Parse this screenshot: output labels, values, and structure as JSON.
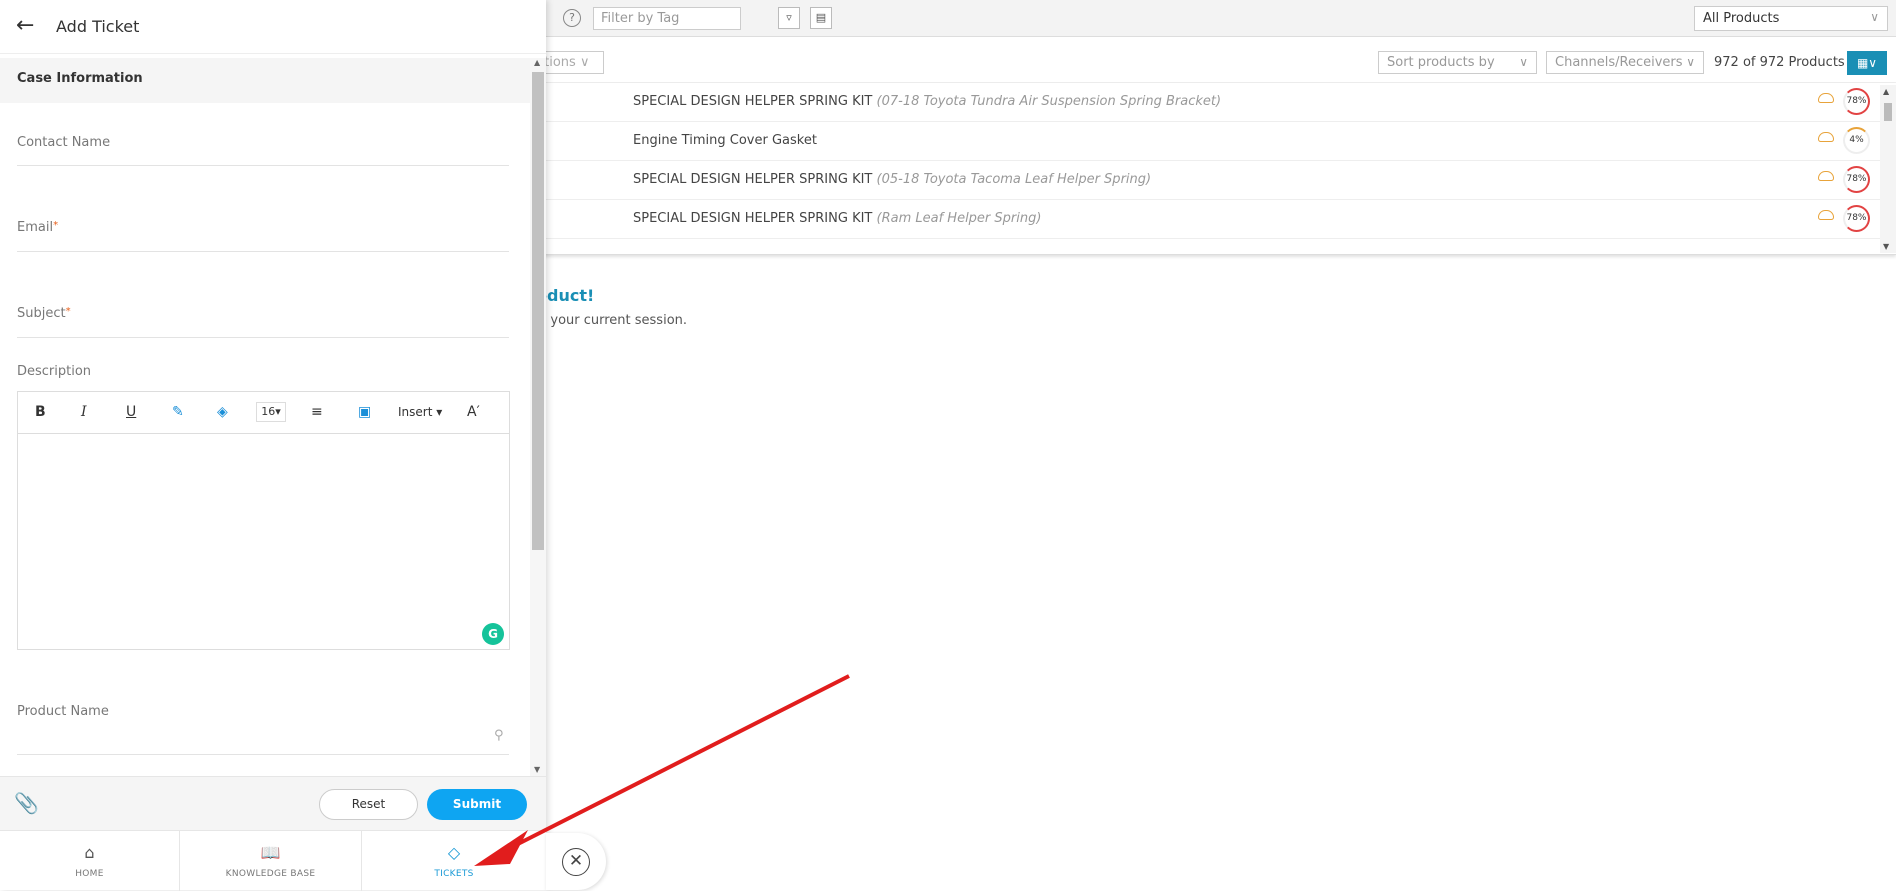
{
  "background": {
    "filter_tag_placeholder": "Filter by Tag",
    "help_icon": "?",
    "product_filter": "All Products",
    "actions_label": "ctions",
    "sort_label": "Sort products by",
    "channels_label": "Channels/Receivers",
    "product_count": "972 of 972 Products",
    "products": [
      {
        "name": "SPECIAL DESIGN HELPER SPRING KIT",
        "note": "(07-18 Toyota Tundra Air Suspension Spring Bracket)",
        "score": "78%"
      },
      {
        "name": "Engine Timing Cover Gasket",
        "note": "",
        "score": "4%"
      },
      {
        "name": "SPECIAL DESIGN HELPER SPRING KIT",
        "note": "(05-18 Toyota Tacoma Leaf Helper Spring)",
        "score": "78%"
      },
      {
        "name": "SPECIAL DESIGN HELPER SPRING KIT",
        "note": "(Ram Leaf Helper Spring)",
        "score": "78%"
      }
    ],
    "message_title": "oduct!",
    "message_sub": "n your current session."
  },
  "panel": {
    "title": "Add Ticket",
    "section": "Case Information",
    "fields": {
      "contact": "Contact Name",
      "email": "Email",
      "subject": "Subject",
      "description": "Description",
      "product": "Product Name"
    },
    "required_mark": "*",
    "editor": {
      "bold": "B",
      "italic": "I",
      "underline": "U",
      "font_size": "16",
      "insert": "Insert"
    },
    "reset": "Reset",
    "submit": "Submit"
  },
  "nav": {
    "home": "HOME",
    "knowledge": "KNOWLEDGE BASE",
    "tickets": "TICKETS"
  },
  "colors": {
    "accent": "#0ea5f2",
    "brand": "#1a8fb5",
    "annotation": "#e11d1d"
  }
}
